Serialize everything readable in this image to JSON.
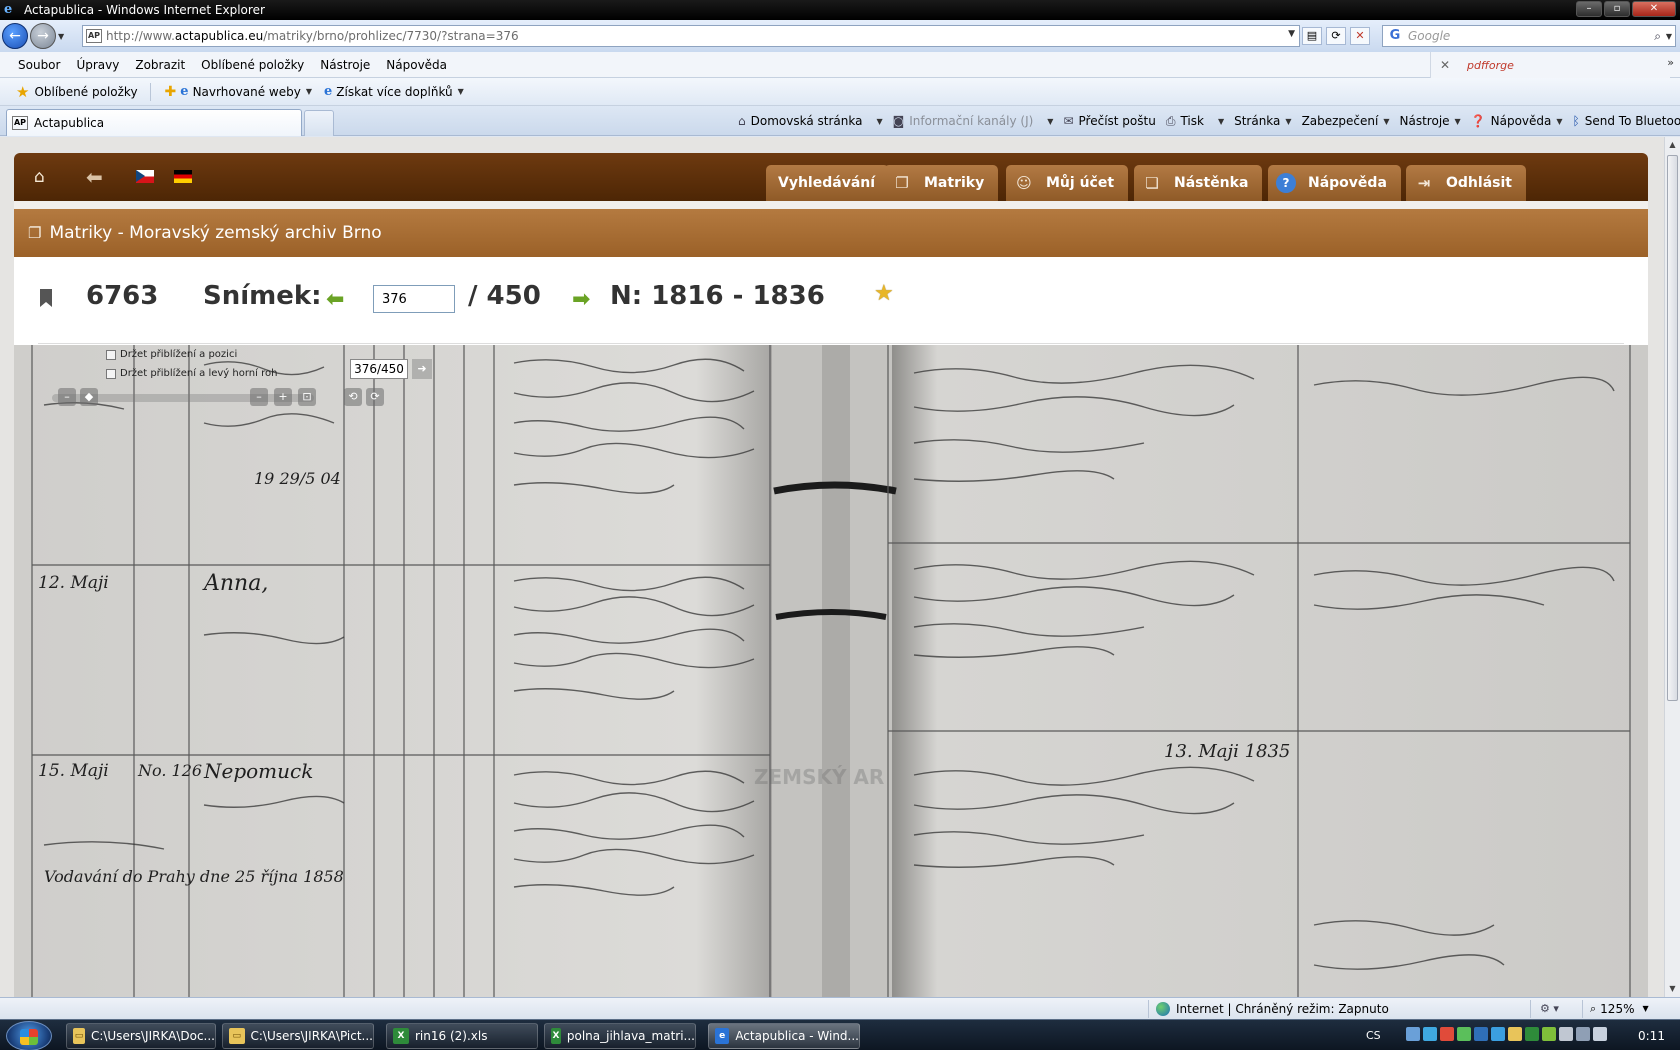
{
  "window": {
    "title": "Actapublica - Windows Internet Explorer"
  },
  "address": {
    "url_prefix": "http://www.",
    "url_host": "actapublica.eu",
    "url_path": "/matriky/brno/prohlizec/7730/?strana=376",
    "search_placeholder": "Google"
  },
  "menu": {
    "items": [
      "Soubor",
      "Úpravy",
      "Zobrazit",
      "Oblíbené položky",
      "Nástroje",
      "Nápověda"
    ]
  },
  "addon": {
    "name": "pdfforge"
  },
  "favbar": {
    "favorites": "Oblíbené položky",
    "suggested": "Navrhované weby",
    "more_addons": "Získat více doplňků"
  },
  "tab": {
    "title": "Actapublica"
  },
  "commandbar": {
    "home": "Domovská stránka",
    "feeds": "Informační kanály (J)",
    "mail": "Přečíst poštu",
    "print": "Tisk",
    "page": "Stránka",
    "safety": "Zabezpečení",
    "tools": "Nástroje",
    "help": "Nápověda",
    "bluetooth": "Send To Bluetooth"
  },
  "site_nav": {
    "search": "Vyhledávání",
    "registers": "Matriky",
    "account": "Můj účet",
    "board": "Nástěnka",
    "help": "Nápověda",
    "logout": "Odhlásit"
  },
  "section": {
    "title": "Matriky - Moravský zemský archiv Brno"
  },
  "viewer": {
    "book_id": "6763",
    "frame_label": "Snímek:",
    "frame_value": "376",
    "frame_total": "/ 450",
    "years": "N: 1816 - 1836",
    "page_badge": "376/450",
    "keep_zoom": "Držet přiblížení a pozici",
    "keep_zoom_corner": "Držet přiblížení a levý horní roh",
    "watermark": "ZEMSKÝ AR",
    "handwriting": {
      "date_12": "12. Maji",
      "name_anna": "Anna,",
      "date_15": "15. Maji",
      "name_nepomuk": "Nepomuck",
      "year_1835": "13. Maji 1835",
      "date_fragment": "19 29/5 04",
      "note_praha": "Vodavání do Prahy dne 25 října 1858",
      "house_no": "No. 126"
    }
  },
  "status": {
    "zone": "Internet | Chráněný režim: Zapnuto",
    "zoom": "125%"
  },
  "taskbar": {
    "items": [
      "C:\\Users\\JIRKA\\Doc...",
      "C:\\Users\\JIRKA\\Pict...",
      "rin16 (2).xls",
      "polna_jihlava_matri...",
      "Actapublica - Wind..."
    ],
    "lang": "CS",
    "time": "0:11"
  }
}
